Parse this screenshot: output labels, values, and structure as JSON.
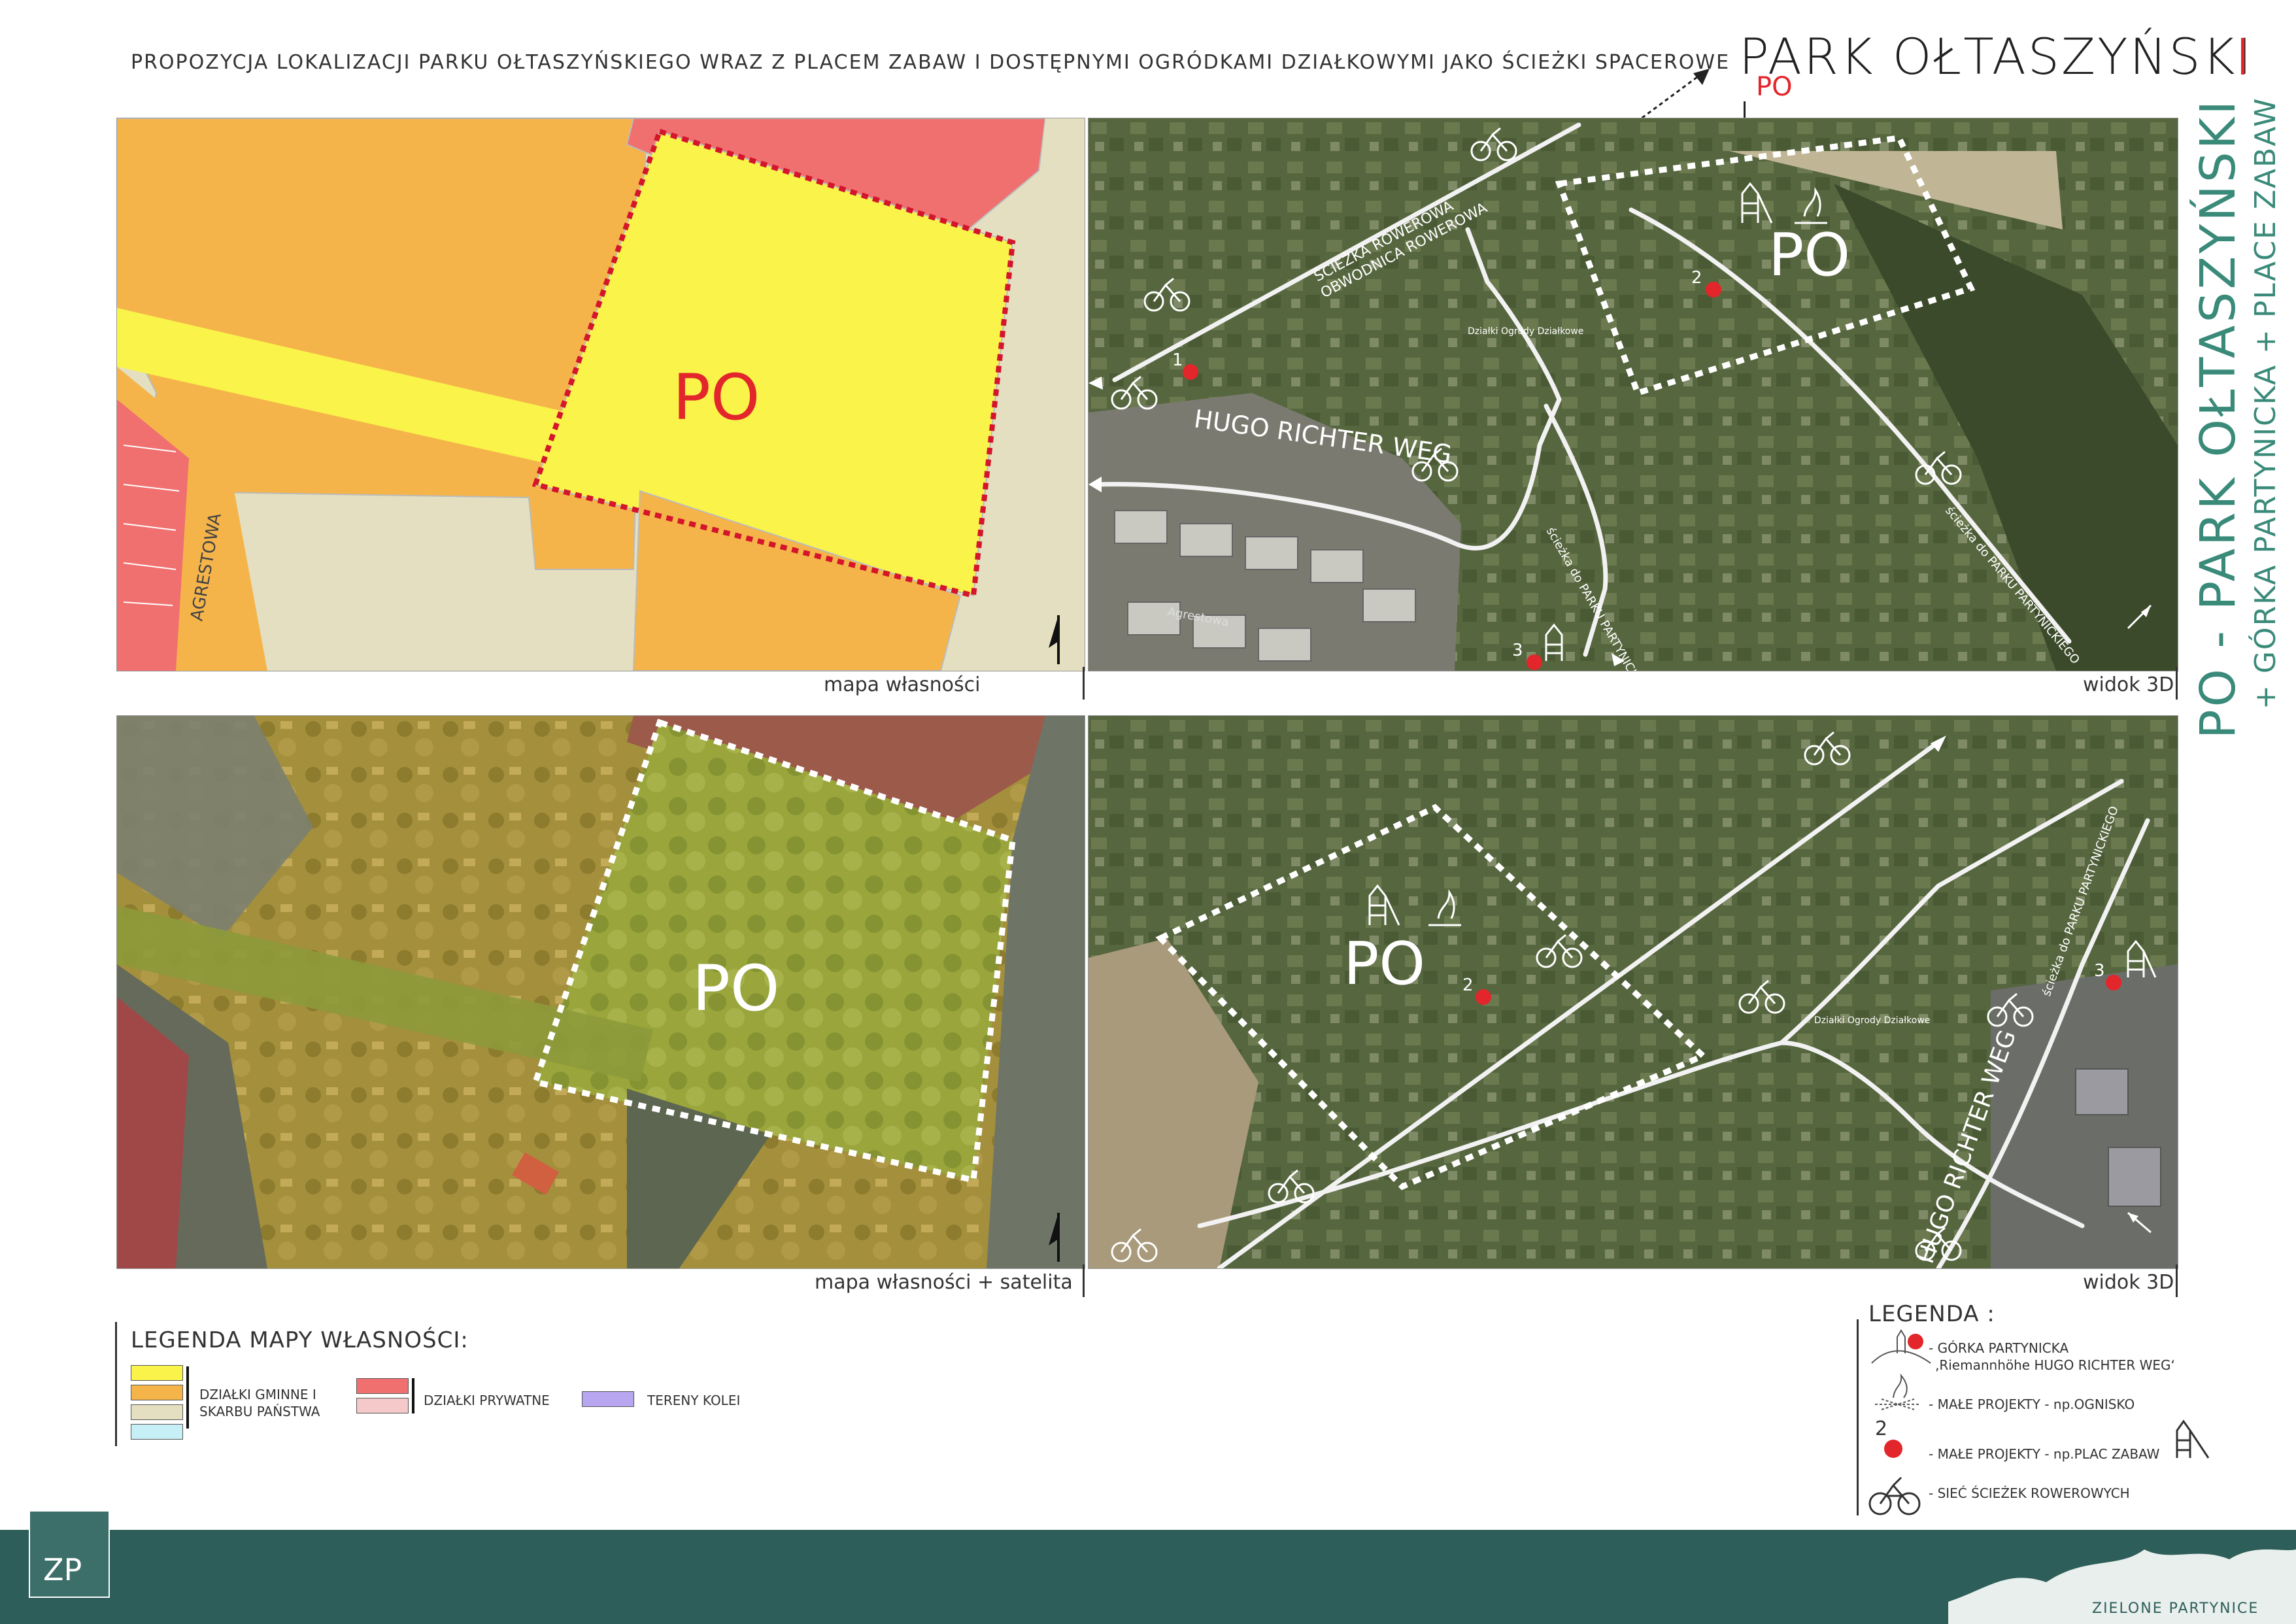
{
  "header": {
    "subtitle": "PROPOZYCJA LOKALIZACJI PARKU OŁTASZYŃSKIEGO WRAZ Z PLACEM ZABAW I DOSTĘPNYMI OGRÓDKAMI DZIAŁKOWYMI JAKO ŚCIEŻKI SPACEROWE",
    "park_name": "PARK OŁTASZYŃSKI",
    "park_code": "PO"
  },
  "side_title": {
    "main": "PO - PARK OŁTASZYŃSKI",
    "sub": "+ GÓRKA PARTYNICKA + PLACE ZABAW"
  },
  "panels": {
    "map_ownership": {
      "caption": "mapa własności",
      "area_label": "PO",
      "street_label": "AGRESTOWA"
    },
    "view3d_top": {
      "caption": "widok 3D",
      "area_label": "PO",
      "road_label": "HUGO RICHTER WEG",
      "bike_path_label_1": "ŚCIEŻKA ROWEROWA",
      "bike_path_label_2": "OBWODNICA ROWEROWA",
      "path_label_1": "ścieżka do PARKU PARTYNICKIEGO",
      "path_label_2": "ścieżka do PARKU PARTYNICKIEGO",
      "street_label": "Agrestowa",
      "gardens_label": "Działki Ogrody Działkowe",
      "marker_1": "1",
      "marker_2": "2",
      "marker_3": "3"
    },
    "map_satellite": {
      "caption": "mapa własności + satelita",
      "area_label": "PO"
    },
    "view3d_bottom": {
      "caption": "widok 3D",
      "area_label": "PO",
      "road_label": "HUGO RICHTER WEG",
      "path_label": "ścieżka do PARKU PARTYNICKIEGO",
      "gardens_label": "Działki Ogrody Działkowe",
      "marker_2": "2",
      "marker_3": "3"
    }
  },
  "ownership_legend": {
    "title": "LEGENDA MAPY WŁASNOŚCI:",
    "municipal": "DZIAŁKI GMINNE I SKARBU PAŃSTWA",
    "private": "DZIAŁKI PRYWATNE",
    "rail": "TERENY KOLEI",
    "colors": {
      "yellow": "#f9f34a",
      "orange": "#f5b44a",
      "beige": "#e3dfc0",
      "light_blue": "#c6f0f5",
      "red": "#f07070",
      "pink": "#f5c9c9",
      "purple": "#b9a6f0"
    }
  },
  "main_legend": {
    "title": "LEGENDA :",
    "hill_1": "- GÓRKA PARTYNICKA",
    "hill_2": "‚Riemannhöhe HUGO RICHTER WEG‘",
    "bonfire": "- MAŁE PROJEKTY - np.OGNISKO",
    "playground": "- MAŁE PROJEKTY - np.PLAC ZABAW",
    "bike": "- SIEĆ ŚCIEŻEK ROWEROWYCH",
    "marker_2": "2"
  },
  "footer": {
    "logo": "ZP",
    "brand": "ZIELONE PARTYNICE"
  },
  "icons": [
    "north-arrow-icon",
    "bicycle-icon",
    "playground-icon",
    "bonfire-icon",
    "hill-icon",
    "red-marker-icon",
    "arrow-icon"
  ],
  "accent_colors": {
    "red": "#e3262b",
    "teal": "#3a8a7a",
    "footer": "#2e5e5a"
  }
}
